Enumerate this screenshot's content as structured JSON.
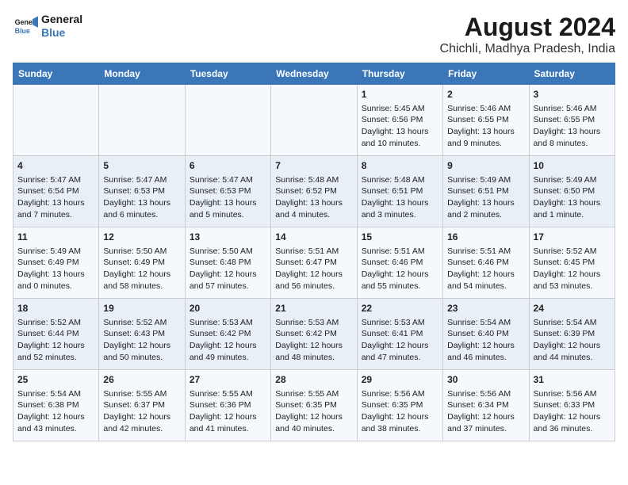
{
  "header": {
    "logo_line1": "General",
    "logo_line2": "Blue",
    "main_title": "August 2024",
    "subtitle": "Chichli, Madhya Pradesh, India"
  },
  "days_of_week": [
    "Sunday",
    "Monday",
    "Tuesday",
    "Wednesday",
    "Thursday",
    "Friday",
    "Saturday"
  ],
  "weeks": [
    [
      {
        "day": "",
        "info": ""
      },
      {
        "day": "",
        "info": ""
      },
      {
        "day": "",
        "info": ""
      },
      {
        "day": "",
        "info": ""
      },
      {
        "day": "1",
        "info": "Sunrise: 5:45 AM\nSunset: 6:56 PM\nDaylight: 13 hours\nand 10 minutes."
      },
      {
        "day": "2",
        "info": "Sunrise: 5:46 AM\nSunset: 6:55 PM\nDaylight: 13 hours\nand 9 minutes."
      },
      {
        "day": "3",
        "info": "Sunrise: 5:46 AM\nSunset: 6:55 PM\nDaylight: 13 hours\nand 8 minutes."
      }
    ],
    [
      {
        "day": "4",
        "info": "Sunrise: 5:47 AM\nSunset: 6:54 PM\nDaylight: 13 hours\nand 7 minutes."
      },
      {
        "day": "5",
        "info": "Sunrise: 5:47 AM\nSunset: 6:53 PM\nDaylight: 13 hours\nand 6 minutes."
      },
      {
        "day": "6",
        "info": "Sunrise: 5:47 AM\nSunset: 6:53 PM\nDaylight: 13 hours\nand 5 minutes."
      },
      {
        "day": "7",
        "info": "Sunrise: 5:48 AM\nSunset: 6:52 PM\nDaylight: 13 hours\nand 4 minutes."
      },
      {
        "day": "8",
        "info": "Sunrise: 5:48 AM\nSunset: 6:51 PM\nDaylight: 13 hours\nand 3 minutes."
      },
      {
        "day": "9",
        "info": "Sunrise: 5:49 AM\nSunset: 6:51 PM\nDaylight: 13 hours\nand 2 minutes."
      },
      {
        "day": "10",
        "info": "Sunrise: 5:49 AM\nSunset: 6:50 PM\nDaylight: 13 hours\nand 1 minute."
      }
    ],
    [
      {
        "day": "11",
        "info": "Sunrise: 5:49 AM\nSunset: 6:49 PM\nDaylight: 13 hours\nand 0 minutes."
      },
      {
        "day": "12",
        "info": "Sunrise: 5:50 AM\nSunset: 6:49 PM\nDaylight: 12 hours\nand 58 minutes."
      },
      {
        "day": "13",
        "info": "Sunrise: 5:50 AM\nSunset: 6:48 PM\nDaylight: 12 hours\nand 57 minutes."
      },
      {
        "day": "14",
        "info": "Sunrise: 5:51 AM\nSunset: 6:47 PM\nDaylight: 12 hours\nand 56 minutes."
      },
      {
        "day": "15",
        "info": "Sunrise: 5:51 AM\nSunset: 6:46 PM\nDaylight: 12 hours\nand 55 minutes."
      },
      {
        "day": "16",
        "info": "Sunrise: 5:51 AM\nSunset: 6:46 PM\nDaylight: 12 hours\nand 54 minutes."
      },
      {
        "day": "17",
        "info": "Sunrise: 5:52 AM\nSunset: 6:45 PM\nDaylight: 12 hours\nand 53 minutes."
      }
    ],
    [
      {
        "day": "18",
        "info": "Sunrise: 5:52 AM\nSunset: 6:44 PM\nDaylight: 12 hours\nand 52 minutes."
      },
      {
        "day": "19",
        "info": "Sunrise: 5:52 AM\nSunset: 6:43 PM\nDaylight: 12 hours\nand 50 minutes."
      },
      {
        "day": "20",
        "info": "Sunrise: 5:53 AM\nSunset: 6:42 PM\nDaylight: 12 hours\nand 49 minutes."
      },
      {
        "day": "21",
        "info": "Sunrise: 5:53 AM\nSunset: 6:42 PM\nDaylight: 12 hours\nand 48 minutes."
      },
      {
        "day": "22",
        "info": "Sunrise: 5:53 AM\nSunset: 6:41 PM\nDaylight: 12 hours\nand 47 minutes."
      },
      {
        "day": "23",
        "info": "Sunrise: 5:54 AM\nSunset: 6:40 PM\nDaylight: 12 hours\nand 46 minutes."
      },
      {
        "day": "24",
        "info": "Sunrise: 5:54 AM\nSunset: 6:39 PM\nDaylight: 12 hours\nand 44 minutes."
      }
    ],
    [
      {
        "day": "25",
        "info": "Sunrise: 5:54 AM\nSunset: 6:38 PM\nDaylight: 12 hours\nand 43 minutes."
      },
      {
        "day": "26",
        "info": "Sunrise: 5:55 AM\nSunset: 6:37 PM\nDaylight: 12 hours\nand 42 minutes."
      },
      {
        "day": "27",
        "info": "Sunrise: 5:55 AM\nSunset: 6:36 PM\nDaylight: 12 hours\nand 41 minutes."
      },
      {
        "day": "28",
        "info": "Sunrise: 5:55 AM\nSunset: 6:35 PM\nDaylight: 12 hours\nand 40 minutes."
      },
      {
        "day": "29",
        "info": "Sunrise: 5:56 AM\nSunset: 6:35 PM\nDaylight: 12 hours\nand 38 minutes."
      },
      {
        "day": "30",
        "info": "Sunrise: 5:56 AM\nSunset: 6:34 PM\nDaylight: 12 hours\nand 37 minutes."
      },
      {
        "day": "31",
        "info": "Sunrise: 5:56 AM\nSunset: 6:33 PM\nDaylight: 12 hours\nand 36 minutes."
      }
    ]
  ]
}
